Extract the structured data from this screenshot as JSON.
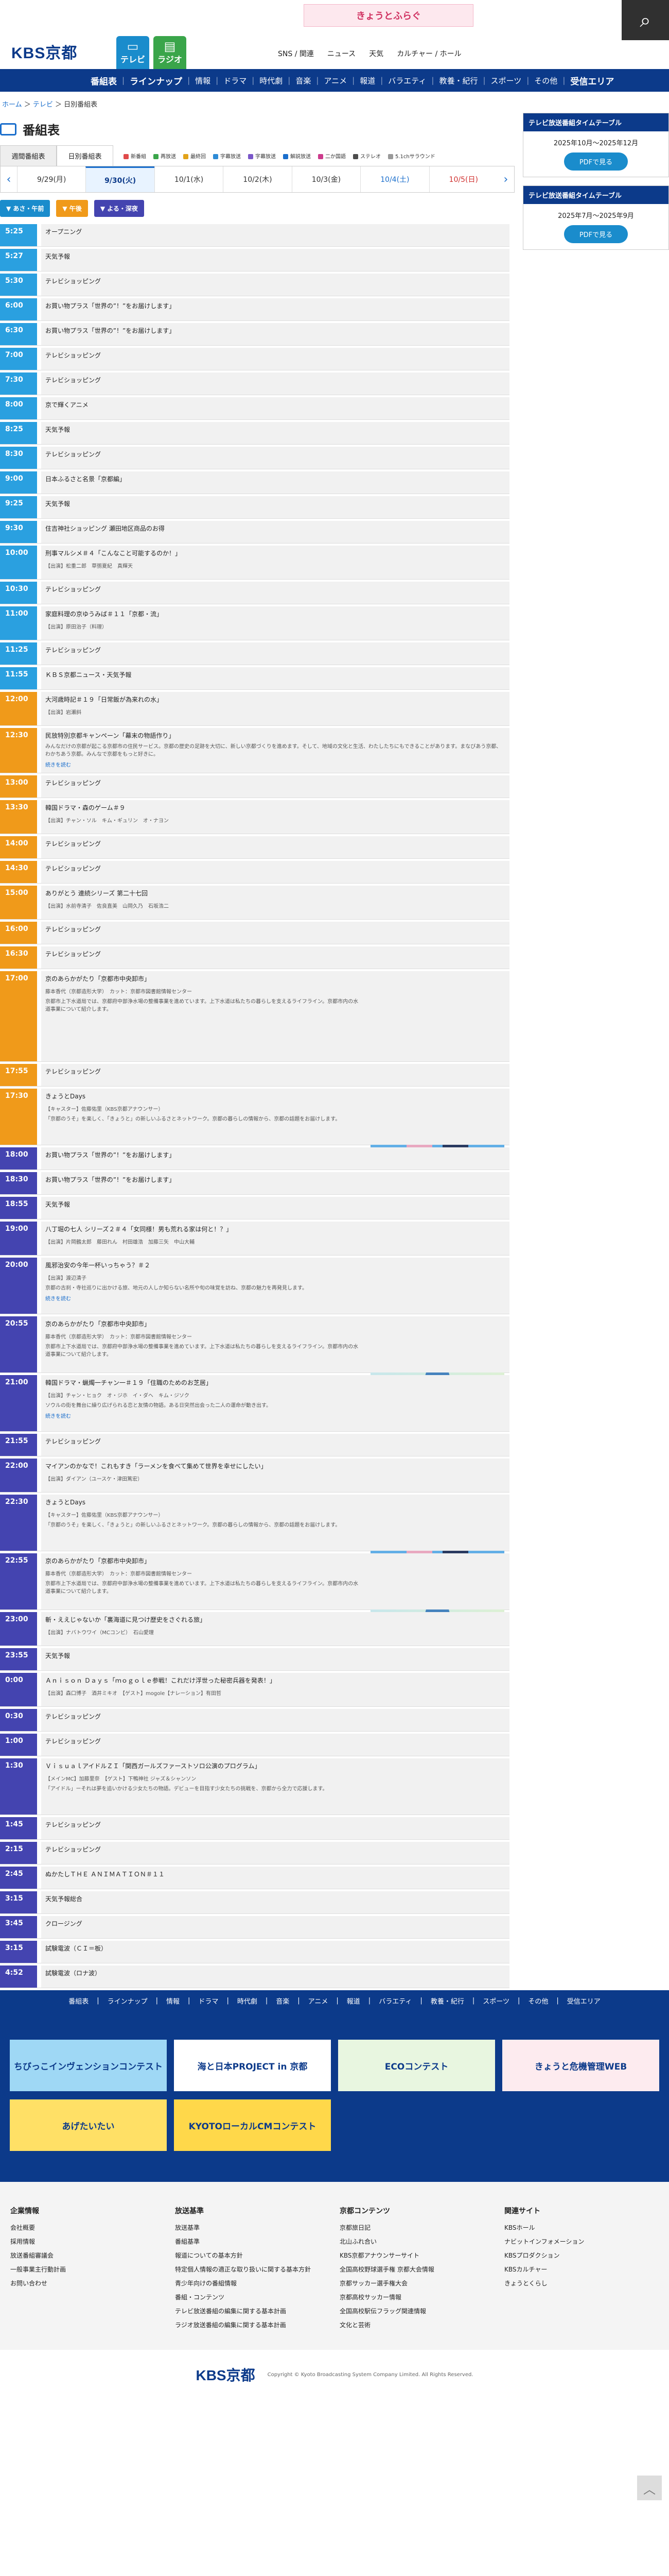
{
  "header": {
    "logo": "KBS京都",
    "banner_text": "きょうとふらぐ",
    "tv_label": "テレビ",
    "radio_label": "ラジオ",
    "links": [
      "SNS / 関連",
      "ニュース",
      "天気",
      "カルチャー / ホール"
    ],
    "search_icon": "search-icon"
  },
  "gnav": [
    "番組表",
    "ラインナップ",
    "情報",
    "ドラマ",
    "時代劇",
    "音楽",
    "アニメ",
    "報道",
    "バラエティ",
    "教養・紀行",
    "スポーツ",
    "その他",
    "受信エリア"
  ],
  "breadcrumb": [
    "ホーム",
    "テレビ",
    "日別番組表"
  ],
  "page_title": "番組表",
  "view_tabs": [
    "週間番組表",
    "日別番組表"
  ],
  "legend": [
    {
      "label": "新番組",
      "color": "#e04a4a"
    },
    {
      "label": "再放送",
      "color": "#3aa54a"
    },
    {
      "label": "最終回",
      "color": "#e2a31a"
    },
    {
      "label": "字幕放送",
      "color": "#2e8bd6"
    },
    {
      "label": "字幕放送",
      "color": "#7a57c9"
    },
    {
      "label": "解説放送",
      "color": "#1a6ecc"
    },
    {
      "label": "二か国語",
      "color": "#cc3b8c"
    },
    {
      "label": "ステレオ",
      "color": "#4c4c4c"
    },
    {
      "label": "5.1chサラウンド",
      "color": "#999"
    }
  ],
  "dates": [
    {
      "label": "9/29(月)",
      "type": "normal"
    },
    {
      "label": "9/30(火)",
      "type": "today"
    },
    {
      "label": "10/1(水)",
      "type": "normal"
    },
    {
      "label": "10/2(木)",
      "type": "normal"
    },
    {
      "label": "10/3(金)",
      "type": "normal"
    },
    {
      "label": "10/4(土)",
      "type": "sat"
    },
    {
      "label": "10/5(日)",
      "type": "sun"
    }
  ],
  "jump": [
    {
      "label": "▼ あさ・午前",
      "color": "#1a8ccc"
    },
    {
      "label": "▼ 午後",
      "color": "#f09a1a"
    },
    {
      "label": "▼ よる・深夜",
      "color": "#4444b0"
    }
  ],
  "programs": [
    {
      "time": "5:25",
      "title": "オープニング",
      "height": 44,
      "band": "morning"
    },
    {
      "time": "5:27",
      "title": "天気予報",
      "height": 44,
      "band": "morning"
    },
    {
      "time": "5:30",
      "title": "テレビショッピング",
      "height": 44,
      "band": "morning"
    },
    {
      "time": "6:00",
      "title": "お買い物プラス「世界の”！”をお届けします」",
      "height": 44,
      "band": "morning"
    },
    {
      "time": "6:30",
      "title": "お買い物プラス「世界の”！”をお届けします」",
      "height": 44,
      "band": "morning"
    },
    {
      "time": "7:00",
      "title": "テレビショッピング",
      "height": 44,
      "band": "morning"
    },
    {
      "time": "7:30",
      "title": "テレビショッピング",
      "height": 44,
      "band": "morning"
    },
    {
      "time": "8:00",
      "title": "京で輝くアニメ",
      "height": 44,
      "band": "morning"
    },
    {
      "time": "8:25",
      "title": "天気予報",
      "height": 44,
      "band": "morning"
    },
    {
      "time": "8:30",
      "title": "テレビショッピング",
      "height": 44,
      "band": "morning"
    },
    {
      "time": "9:00",
      "title": "日本ふるさと名景「京都編」",
      "height": 44,
      "band": "morning"
    },
    {
      "time": "9:25",
      "title": "天気予報",
      "height": 44,
      "band": "morning"
    },
    {
      "time": "9:30",
      "title": "住吉神社ショッピング 瀬田地区商品のお得",
      "height": 44,
      "band": "morning"
    },
    {
      "time": "10:00",
      "title": "刑事マルシメ＃４「こんなこと可能するのか！」",
      "sub": "【出演】松重二郎　草彅夏紀　真輝天",
      "height": 66,
      "band": "morning"
    },
    {
      "time": "10:30",
      "title": "テレビショッピング",
      "height": 44,
      "band": "morning"
    },
    {
      "time": "11:00",
      "title": "家庭料理の京ゆうみば＃１１「京都・流」",
      "sub": "【出演】原田治子（料理）",
      "height": 66,
      "band": "morning"
    },
    {
      "time": "11:25",
      "title": "テレビショッピング",
      "height": 44,
      "band": "morning"
    },
    {
      "time": "11:55",
      "title": "ＫＢＳ京都ニュース・天気予報",
      "height": 44,
      "band": "morning"
    },
    {
      "time": "12:00",
      "title": "大河歳時記＃１９「日常飯が為来れの水」",
      "sub": "【出演】岩瀬斜",
      "height": 66,
      "band": "afternoon"
    },
    {
      "time": "12:30",
      "title": "民放特別京都キャンペーン「幕末の物語作り」",
      "desc": "みんなだけの京都が起こる京都市の住民サービス。京都の歴史の足跡を大切に、新しい京都づくりを進めます。そして、地域の文化と生活、わたしたちにもできることがあります。まなびあう京都、わかちあう京都。みんなで京都をもっと好きに。",
      "more": "続きを読む",
      "height": 88,
      "band": "afternoon"
    },
    {
      "time": "13:00",
      "title": "テレビショッピング",
      "height": 44,
      "band": "afternoon"
    },
    {
      "time": "13:30",
      "title": "韓国ドラマ・森のゲーム＃９",
      "sub": "【出演】チャン・ソル　キム・ギュリン　オ・ナヨン",
      "height": 66,
      "band": "afternoon"
    },
    {
      "time": "14:00",
      "title": "テレビショッピング",
      "height": 44,
      "band": "afternoon"
    },
    {
      "time": "14:30",
      "title": "テレビショッピング",
      "height": 44,
      "band": "afternoon"
    },
    {
      "time": "15:00",
      "title": "ありがとう 連続シリーズ 第二十七回",
      "sub": "【出演】水前寺清子　佐良直美　山岡久乃　石坂浩二",
      "height": 66,
      "band": "afternoon"
    },
    {
      "time": "16:00",
      "title": "テレビショッピング",
      "height": 44,
      "band": "afternoon"
    },
    {
      "time": "16:30",
      "title": "テレビショッピング",
      "height": 44,
      "band": "afternoon"
    },
    {
      "time": "17:00",
      "title": "京のあらかがたり「京都市中央卸市」",
      "sub": "藤本香代（京都造形大学）　カット：京都市図書館情報センター",
      "desc": "京都市上下水道局では、京都府中部浄水場の整備事業を進めています。上下水道は私たちの暮らしを支えるライフライン。京都市内の水道事業について紹介します。",
      "icons": 2,
      "thumb": "kyoto",
      "height": 176,
      "band": "afternoon"
    },
    {
      "time": "17:55",
      "title": "テレビショッピング",
      "height": 44,
      "band": "afternoon"
    },
    {
      "time": "17:30",
      "title": "きょうとDays",
      "sub": "【キャスター】佐藤佑里（KBS京都アナウンサー）",
      "desc": "「京都のうそ」を楽しく、「きょうと」の新しいふるさとネットワーク。京都の暮らしの情報から、京都の話題をお届けします。",
      "icons": 2,
      "thumb": "kyo",
      "height": 110,
      "band": "afternoon"
    },
    {
      "time": "18:00",
      "title": "お買い物プラス「世界の”！”をお届けします」",
      "height": 44,
      "band": "night"
    },
    {
      "time": "18:30",
      "title": "お買い物プラス「世界の”！”をお届けします」",
      "height": 44,
      "band": "night"
    },
    {
      "time": "18:55",
      "title": "天気予報",
      "height": 44,
      "band": "night"
    },
    {
      "time": "19:00",
      "title": "八丁堀の七人 シリーズ２＃４「女同様！男も荒れる家は何と！？」",
      "sub": "【出演】片岡鶴太郎　藤田れん　村田雄浩　加藤三矢　中山大輔",
      "height": 66,
      "band": "night"
    },
    {
      "time": "20:00",
      "title": "風邪治安の今年一杯いっちゃう？＃２",
      "sub": "【出演】渡辺清子",
      "desc": "京都の古刹・寺社巡りに出かける旅、地元の人しか知らない名所や旬の味覚を訪ね、京都の魅力を再発見します。",
      "more": "続きを読む",
      "height": 110,
      "band": "night"
    },
    {
      "time": "20:55",
      "title": "京のあらかがたり「京都市中央卸市」",
      "sub": "藤本香代（京都造形大学）　カット：京都市図書館情報センター",
      "desc": "京都市上下水道局では、京都府中部浄水場の整備事業を進めています。上下水道は私たちの暮らしを支えるライフライン。京都市内の水道事業について紹介します。",
      "icons": 2,
      "thumb": "kyoto",
      "height": 110,
      "band": "night"
    },
    {
      "time": "21:00",
      "title": "韓国ドラマ・蝋燭一チャン一＃１９「住職のためのお芝居」",
      "sub": "【出演】チャン・ヒョク　オ・ジホ　イ・ダヘ　キム・ジソク",
      "desc": "ソウルの街を舞台に繰り広げられる恋と友情の物語。ある日突然出会った二人の運命が動き出す。",
      "more": "続きを読む",
      "height": 110,
      "band": "night"
    },
    {
      "time": "21:55",
      "title": "テレビショッピング",
      "height": 44,
      "band": "night"
    },
    {
      "time": "22:00",
      "title": "マイアンのかなで！これもすき「ラーメンを食べて集めて世界を幸せにしたい」",
      "sub": "【出演】ダイアン（ユースケ・津田篤宏）",
      "height": 66,
      "band": "night"
    },
    {
      "time": "22:30",
      "title": "きょうとDays",
      "sub": "【キャスター】佐藤佑里（KBS京都アナウンサー）",
      "desc": "「京都のうそ」を楽しく、「きょうと」の新しいふるさとネットワーク。京都の暮らしの情報から、京都の話題をお届けします。",
      "icons": 2,
      "thumb": "kyo",
      "height": 110,
      "band": "night"
    },
    {
      "time": "22:55",
      "title": "京のあらかがたり「京都市中央卸市」",
      "sub": "藤本香代（京都造形大学）　カット：京都市図書館情報センター",
      "desc": "京都市上下水道局では、京都府中部浄水場の整備事業を進めています。上下水道は私たちの暮らしを支えるライフライン。京都市内の水道事業について紹介します。",
      "icons": 2,
      "thumb": "kyoto",
      "height": 110,
      "band": "night"
    },
    {
      "time": "23:00",
      "title": "斬・ええじゃないか「裏海道に見つけ歴史をさぐれる旅」",
      "sub": "【出演】ナバトウワイ（MCコンビ）　石山愛理",
      "height": 66,
      "band": "night"
    },
    {
      "time": "23:55",
      "title": "天気予報",
      "height": 44,
      "band": "night"
    },
    {
      "time": "0:00",
      "title": "Ａｎｉｓｏｎ Ｄａｙｓ「ｍｏｇｏｌｅ参戦！これだけ浮世った秘密兵器を発表！」",
      "sub": "【出演】森口博子　酒井ミキオ　【ゲスト】mogole【ナレーション】有田哲",
      "height": 66,
      "band": "night"
    },
    {
      "time": "0:30",
      "title": "テレビショッピング",
      "height": 44,
      "band": "night"
    },
    {
      "time": "1:00",
      "title": "テレビショッピング",
      "height": 44,
      "band": "night"
    },
    {
      "time": "1:30",
      "title": "ＶｉｓｕａｌアイドルＺＩ「関西ガールズファーストソロ公演のプログラム」",
      "sub": "【メインMC】加藤里奈　【ゲスト】下鴨神社 ジャズ＆シャンソン",
      "desc": "「アイドル」ーそれは夢を追いかける少女たちの物語。デビューを目指す少女たちの挑戦を、京都から全力で応援します。",
      "height": 110,
      "band": "night"
    },
    {
      "time": "1:45",
      "title": "テレビショッピング",
      "height": 44,
      "band": "night"
    },
    {
      "time": "2:15",
      "title": "テレビショッピング",
      "height": 44,
      "band": "night"
    },
    {
      "time": "2:45",
      "title": "ぬかたしＴＨＥ ＡＮＩＭＡＴＩＯＮ＃１１",
      "height": 44,
      "band": "night"
    },
    {
      "time": "3:15",
      "title": "天気予報総合",
      "height": 44,
      "band": "night"
    },
    {
      "time": "3:45",
      "title": "クロージング",
      "height": 44,
      "band": "night"
    },
    {
      "time": "3:15",
      "title": "試験電波（ＣＩ＝板）",
      "height": 44,
      "band": "night"
    },
    {
      "time": "4:52",
      "title": "試験電波（ロナ波）",
      "height": 44,
      "band": "night"
    }
  ],
  "band_colors": {
    "morning": "#2aa0e0",
    "afternoon": "#f09a1a",
    "night": "#4444b0"
  },
  "sidebar": [
    {
      "head": "テレビ放送番組タイムテーブル",
      "range": "2025年10月〜2025年12月",
      "btn": "PDFで見る"
    },
    {
      "head": "テレビ放送番組タイムテーブル",
      "range": "2025年7月〜2025年9月",
      "btn": "PDFで見る"
    }
  ],
  "footer_nav": [
    "番組表",
    "ラインナップ",
    "情報",
    "ドラマ",
    "時代劇",
    "音楽",
    "アニメ",
    "報道",
    "バラエティ",
    "教養・紀行",
    "スポーツ",
    "その他",
    "受信エリア"
  ],
  "banners": [
    {
      "text": "ちびっこインヴェンションコンテスト",
      "bg": "#9fd8f5"
    },
    {
      "text": "海と日本PROJECT in 京都",
      "bg": "#ffffff"
    },
    {
      "text": "ECOコンテスト",
      "bg": "#e8f6e0"
    },
    {
      "text": "きょうと危機管理WEB",
      "bg": "#fdebef"
    },
    {
      "text": "あげたいたい",
      "bg": "#ffe066"
    },
    {
      "text": "KYOTOローカルCMコンテスト",
      "bg": "#ffd84a"
    }
  ],
  "footer_cols": [
    {
      "head": "企業情報",
      "items": [
        "会社概要",
        "採用情報",
        "放送番組審議会",
        "一般事業主行動計画",
        "お問い合わせ"
      ]
    },
    {
      "head": "放送基準",
      "items": [
        "放送基準",
        "番組基準",
        "報道についての基本方針",
        "特定個人情報の適正な取り扱いに関する基本方針",
        "青少年向けの番組情報",
        "番組・コンテンツ",
        "テレビ放送番組の編集に関する基本計画",
        "ラジオ放送番組の編集に関する基本計画"
      ]
    },
    {
      "head": "京都コンテンツ",
      "items": [
        "京都旅日記",
        "北山ふれ合い",
        "KBS京都アナウンサーサイト",
        "全国高校野球選手権 京都大会情報",
        "京都サッカー選手権大会",
        "京都高校サッカー情報",
        "全国高校駅伝フラッグ関連情報",
        "文化と芸術"
      ]
    },
    {
      "head": "関連サイト",
      "items": [
        "KBSホール",
        "ナビットインフォメーション",
        "KBSプロダクション",
        "KBSカルチャー",
        "きょうとくらし"
      ]
    }
  ],
  "copyright": "Copyright © Kyoto Broadcasting System Company Limited. All Rights Reserved."
}
